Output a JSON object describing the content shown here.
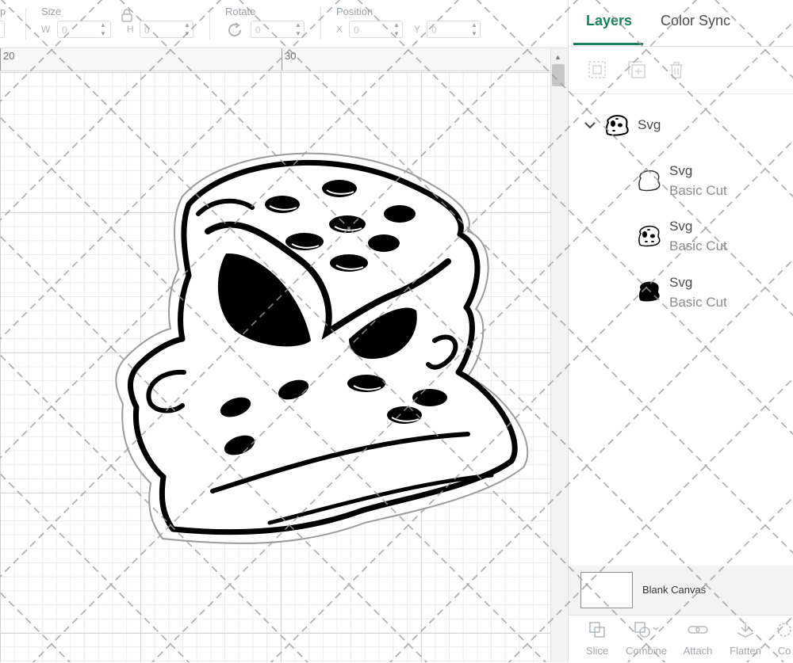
{
  "toolbar": {
    "cut_label": "p",
    "size_label": "Size",
    "w_label": "W",
    "w_value": "0",
    "h_label": "H",
    "h_value": "0",
    "rotate_label": "Rotate",
    "rotate_value": "0",
    "position_label": "Position",
    "x_label": "X",
    "x_value": "0",
    "y_label": "Y",
    "y_value": "0"
  },
  "ruler": {
    "marks": [
      "20",
      "30"
    ]
  },
  "panel": {
    "tabs": [
      {
        "label": "Layers",
        "active": true
      },
      {
        "label": "Color Sync",
        "active": false
      }
    ],
    "group": {
      "name": "Svg"
    },
    "layers": [
      {
        "name": "Svg",
        "operation": "Basic Cut",
        "thumb": "outline-icon"
      },
      {
        "name": "Svg",
        "operation": "Basic Cut",
        "thumb": "duck-detail-icon"
      },
      {
        "name": "Svg",
        "operation": "Basic Cut",
        "thumb": "silhouette-icon"
      }
    ],
    "blank_canvas_label": "Blank Canvas",
    "bottom_actions": [
      {
        "label": "Slice",
        "icon": "slice-icon"
      },
      {
        "label": "Combine",
        "icon": "combine-icon"
      },
      {
        "label": "Attach",
        "icon": "attach-icon"
      },
      {
        "label": "Flatten",
        "icon": "flatten-icon"
      },
      {
        "label": "Co",
        "icon": "contour-icon"
      }
    ]
  },
  "colors": {
    "accent": "#1a7f5a",
    "grid": "#d3d3d3"
  }
}
